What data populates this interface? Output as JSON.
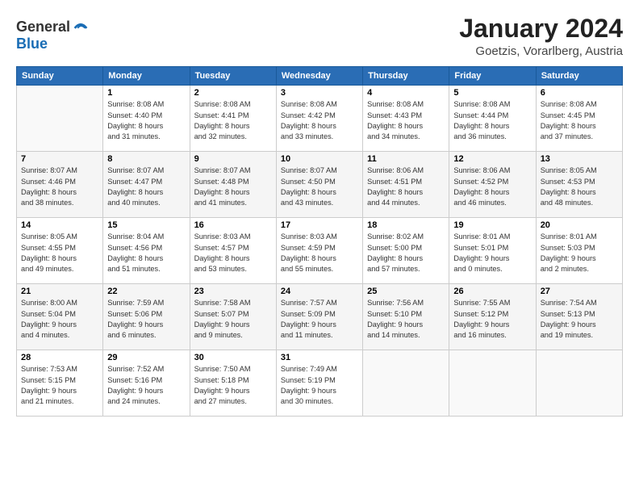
{
  "header": {
    "logo_line1": "General",
    "logo_line2": "Blue",
    "month": "January 2024",
    "location": "Goetzis, Vorarlberg, Austria"
  },
  "weekdays": [
    "Sunday",
    "Monday",
    "Tuesday",
    "Wednesday",
    "Thursday",
    "Friday",
    "Saturday"
  ],
  "weeks": [
    [
      {
        "day": "",
        "sunrise": "",
        "sunset": "",
        "daylight": ""
      },
      {
        "day": "1",
        "sunrise": "Sunrise: 8:08 AM",
        "sunset": "Sunset: 4:40 PM",
        "daylight": "Daylight: 8 hours and 31 minutes."
      },
      {
        "day": "2",
        "sunrise": "Sunrise: 8:08 AM",
        "sunset": "Sunset: 4:41 PM",
        "daylight": "Daylight: 8 hours and 32 minutes."
      },
      {
        "day": "3",
        "sunrise": "Sunrise: 8:08 AM",
        "sunset": "Sunset: 4:42 PM",
        "daylight": "Daylight: 8 hours and 33 minutes."
      },
      {
        "day": "4",
        "sunrise": "Sunrise: 8:08 AM",
        "sunset": "Sunset: 4:43 PM",
        "daylight": "Daylight: 8 hours and 34 minutes."
      },
      {
        "day": "5",
        "sunrise": "Sunrise: 8:08 AM",
        "sunset": "Sunset: 4:44 PM",
        "daylight": "Daylight: 8 hours and 36 minutes."
      },
      {
        "day": "6",
        "sunrise": "Sunrise: 8:08 AM",
        "sunset": "Sunset: 4:45 PM",
        "daylight": "Daylight: 8 hours and 37 minutes."
      }
    ],
    [
      {
        "day": "7",
        "sunrise": "Sunrise: 8:07 AM",
        "sunset": "Sunset: 4:46 PM",
        "daylight": "Daylight: 8 hours and 38 minutes."
      },
      {
        "day": "8",
        "sunrise": "Sunrise: 8:07 AM",
        "sunset": "Sunset: 4:47 PM",
        "daylight": "Daylight: 8 hours and 40 minutes."
      },
      {
        "day": "9",
        "sunrise": "Sunrise: 8:07 AM",
        "sunset": "Sunset: 4:48 PM",
        "daylight": "Daylight: 8 hours and 41 minutes."
      },
      {
        "day": "10",
        "sunrise": "Sunrise: 8:07 AM",
        "sunset": "Sunset: 4:50 PM",
        "daylight": "Daylight: 8 hours and 43 minutes."
      },
      {
        "day": "11",
        "sunrise": "Sunrise: 8:06 AM",
        "sunset": "Sunset: 4:51 PM",
        "daylight": "Daylight: 8 hours and 44 minutes."
      },
      {
        "day": "12",
        "sunrise": "Sunrise: 8:06 AM",
        "sunset": "Sunset: 4:52 PM",
        "daylight": "Daylight: 8 hours and 46 minutes."
      },
      {
        "day": "13",
        "sunrise": "Sunrise: 8:05 AM",
        "sunset": "Sunset: 4:53 PM",
        "daylight": "Daylight: 8 hours and 48 minutes."
      }
    ],
    [
      {
        "day": "14",
        "sunrise": "Sunrise: 8:05 AM",
        "sunset": "Sunset: 4:55 PM",
        "daylight": "Daylight: 8 hours and 49 minutes."
      },
      {
        "day": "15",
        "sunrise": "Sunrise: 8:04 AM",
        "sunset": "Sunset: 4:56 PM",
        "daylight": "Daylight: 8 hours and 51 minutes."
      },
      {
        "day": "16",
        "sunrise": "Sunrise: 8:03 AM",
        "sunset": "Sunset: 4:57 PM",
        "daylight": "Daylight: 8 hours and 53 minutes."
      },
      {
        "day": "17",
        "sunrise": "Sunrise: 8:03 AM",
        "sunset": "Sunset: 4:59 PM",
        "daylight": "Daylight: 8 hours and 55 minutes."
      },
      {
        "day": "18",
        "sunrise": "Sunrise: 8:02 AM",
        "sunset": "Sunset: 5:00 PM",
        "daylight": "Daylight: 8 hours and 57 minutes."
      },
      {
        "day": "19",
        "sunrise": "Sunrise: 8:01 AM",
        "sunset": "Sunset: 5:01 PM",
        "daylight": "Daylight: 9 hours and 0 minutes."
      },
      {
        "day": "20",
        "sunrise": "Sunrise: 8:01 AM",
        "sunset": "Sunset: 5:03 PM",
        "daylight": "Daylight: 9 hours and 2 minutes."
      }
    ],
    [
      {
        "day": "21",
        "sunrise": "Sunrise: 8:00 AM",
        "sunset": "Sunset: 5:04 PM",
        "daylight": "Daylight: 9 hours and 4 minutes."
      },
      {
        "day": "22",
        "sunrise": "Sunrise: 7:59 AM",
        "sunset": "Sunset: 5:06 PM",
        "daylight": "Daylight: 9 hours and 6 minutes."
      },
      {
        "day": "23",
        "sunrise": "Sunrise: 7:58 AM",
        "sunset": "Sunset: 5:07 PM",
        "daylight": "Daylight: 9 hours and 9 minutes."
      },
      {
        "day": "24",
        "sunrise": "Sunrise: 7:57 AM",
        "sunset": "Sunset: 5:09 PM",
        "daylight": "Daylight: 9 hours and 11 minutes."
      },
      {
        "day": "25",
        "sunrise": "Sunrise: 7:56 AM",
        "sunset": "Sunset: 5:10 PM",
        "daylight": "Daylight: 9 hours and 14 minutes."
      },
      {
        "day": "26",
        "sunrise": "Sunrise: 7:55 AM",
        "sunset": "Sunset: 5:12 PM",
        "daylight": "Daylight: 9 hours and 16 minutes."
      },
      {
        "day": "27",
        "sunrise": "Sunrise: 7:54 AM",
        "sunset": "Sunset: 5:13 PM",
        "daylight": "Daylight: 9 hours and 19 minutes."
      }
    ],
    [
      {
        "day": "28",
        "sunrise": "Sunrise: 7:53 AM",
        "sunset": "Sunset: 5:15 PM",
        "daylight": "Daylight: 9 hours and 21 minutes."
      },
      {
        "day": "29",
        "sunrise": "Sunrise: 7:52 AM",
        "sunset": "Sunset: 5:16 PM",
        "daylight": "Daylight: 9 hours and 24 minutes."
      },
      {
        "day": "30",
        "sunrise": "Sunrise: 7:50 AM",
        "sunset": "Sunset: 5:18 PM",
        "daylight": "Daylight: 9 hours and 27 minutes."
      },
      {
        "day": "31",
        "sunrise": "Sunrise: 7:49 AM",
        "sunset": "Sunset: 5:19 PM",
        "daylight": "Daylight: 9 hours and 30 minutes."
      },
      {
        "day": "",
        "sunrise": "",
        "sunset": "",
        "daylight": ""
      },
      {
        "day": "",
        "sunrise": "",
        "sunset": "",
        "daylight": ""
      },
      {
        "day": "",
        "sunrise": "",
        "sunset": "",
        "daylight": ""
      }
    ]
  ]
}
